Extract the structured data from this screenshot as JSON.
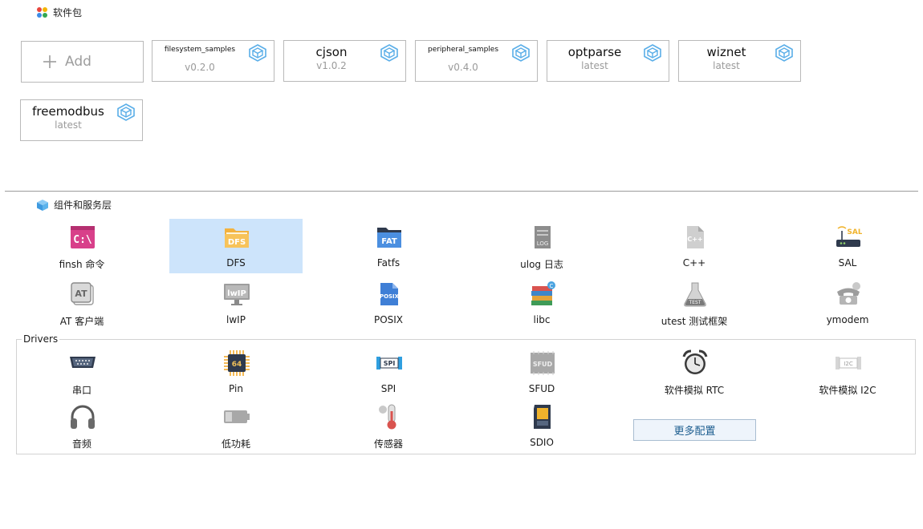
{
  "packages_section": {
    "title": "软件包"
  },
  "add_card": {
    "label": "Add"
  },
  "packages": [
    {
      "name": "filesystem_samples",
      "version": "v0.2.0",
      "size": "small"
    },
    {
      "name": "cjson",
      "version": "v1.0.2",
      "size": "big"
    },
    {
      "name": "peripheral_samples",
      "version": "v0.4.0",
      "size": "small"
    },
    {
      "name": "optparse",
      "version": "latest",
      "size": "big"
    },
    {
      "name": "wiznet",
      "version": "latest",
      "size": "big"
    },
    {
      "name": "freemodbus",
      "version": "latest",
      "size": "big"
    }
  ],
  "components_section": {
    "title": "组件和服务层"
  },
  "components": [
    {
      "label": "finsh 命令",
      "icon": "finsh-icon"
    },
    {
      "label": "DFS",
      "icon": "dfs-folder-icon",
      "selected": true
    },
    {
      "label": "Fatfs",
      "icon": "fatfs-folder-icon"
    },
    {
      "label": "ulog 日志",
      "icon": "log-file-icon"
    },
    {
      "label": "C++",
      "icon": "cpp-file-icon"
    },
    {
      "label": "SAL",
      "icon": "router-icon"
    },
    {
      "label": "AT 客户端",
      "icon": "at-icon"
    },
    {
      "label": "lwIP",
      "icon": "monitor-icon"
    },
    {
      "label": "POSIX",
      "icon": "posix-file-icon"
    },
    {
      "label": "libc",
      "icon": "books-icon"
    },
    {
      "label": "utest 测试框架",
      "icon": "flask-icon"
    },
    {
      "label": "ymodem",
      "icon": "telephone-icon"
    }
  ],
  "drivers": {
    "legend": "Drivers",
    "items": [
      {
        "label": "串口",
        "icon": "serial-port-icon"
      },
      {
        "label": "Pin",
        "icon": "chip-icon"
      },
      {
        "label": "SPI",
        "icon": "spi-icon"
      },
      {
        "label": "SFUD",
        "icon": "sfud-icon"
      },
      {
        "label": "软件模拟 RTC",
        "icon": "alarm-clock-icon"
      },
      {
        "label": "软件模拟 I2C",
        "icon": "i2c-icon"
      },
      {
        "label": "音频",
        "icon": "headphones-icon"
      },
      {
        "label": "低功耗",
        "icon": "battery-icon"
      },
      {
        "label": "传感器",
        "icon": "thermometer-icon"
      },
      {
        "label": "SDIO",
        "icon": "sd-card-icon"
      }
    ],
    "more_button": "更多配置"
  },
  "colors": {
    "selected": "#cde4fb",
    "accent": "#4aa3e0"
  }
}
